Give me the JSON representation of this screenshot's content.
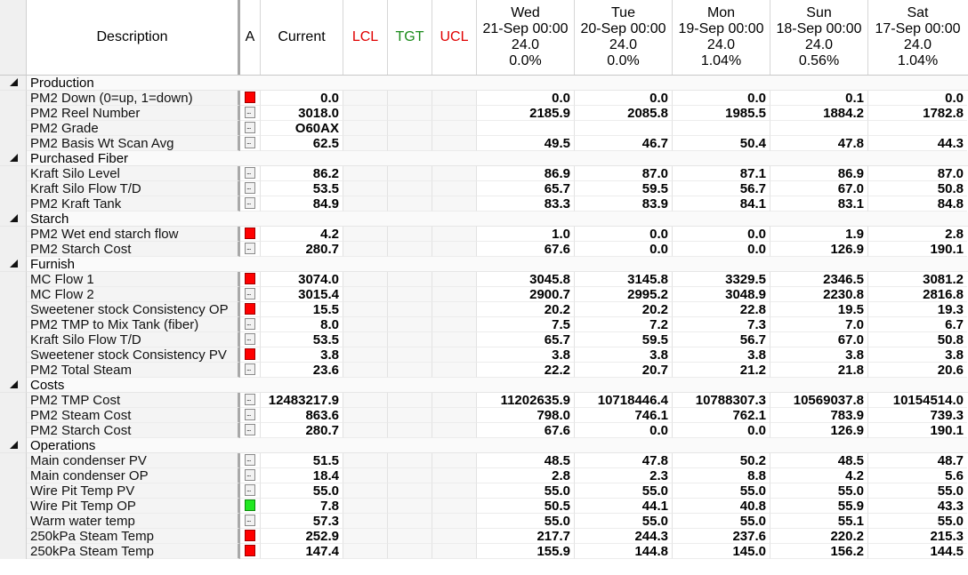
{
  "header": {
    "description": "Description",
    "a": "A",
    "current": "Current",
    "lcl": "LCL",
    "tgt": "TGT",
    "ucl": "UCL",
    "days": [
      {
        "day": "Wed",
        "date": "21-Sep 00:00",
        "hours": "24.0",
        "pct": "0.0%"
      },
      {
        "day": "Tue",
        "date": "20-Sep 00:00",
        "hours": "24.0",
        "pct": "0.0%"
      },
      {
        "day": "Mon",
        "date": "19-Sep 00:00",
        "hours": "24.0",
        "pct": "1.04%"
      },
      {
        "day": "Sun",
        "date": "18-Sep 00:00",
        "hours": "24.0",
        "pct": "0.56%"
      },
      {
        "day": "Sat",
        "date": "17-Sep 00:00",
        "hours": "24.0",
        "pct": "1.04%"
      }
    ]
  },
  "colors": {
    "alarm_red": "#ff0000",
    "alarm_green": "#22e822",
    "lcl": "#e00000",
    "tgt": "#1a8a1a",
    "ucl": "#e00000"
  },
  "groups": [
    {
      "name": "Production",
      "rows": [
        {
          "desc": "PM2 Down (0=up, 1=down)",
          "alarm": "red",
          "current": "0.0",
          "values": [
            "0.0",
            "0.0",
            "0.0",
            "0.1",
            "0.0"
          ]
        },
        {
          "desc": "PM2 Reel Number",
          "alarm": "grey",
          "current": "3018.0",
          "values": [
            "2185.9",
            "2085.8",
            "1985.5",
            "1884.2",
            "1782.8"
          ]
        },
        {
          "desc": "PM2 Grade",
          "alarm": "grey",
          "current": "O60AX",
          "values": [
            "",
            "",
            "",
            "",
            ""
          ]
        },
        {
          "desc": "PM2 Basis Wt Scan Avg",
          "alarm": "grey",
          "current": "62.5",
          "values": [
            "49.5",
            "46.7",
            "50.4",
            "47.8",
            "44.3"
          ]
        }
      ]
    },
    {
      "name": "Purchased Fiber",
      "rows": [
        {
          "desc": "Kraft Silo Level",
          "alarm": "grey",
          "current": "86.2",
          "values": [
            "86.9",
            "87.0",
            "87.1",
            "86.9",
            "87.0"
          ]
        },
        {
          "desc": "Kraft Silo Flow T/D",
          "alarm": "grey",
          "current": "53.5",
          "values": [
            "65.7",
            "59.5",
            "56.7",
            "67.0",
            "50.8"
          ]
        },
        {
          "desc": "PM2 Kraft Tank",
          "alarm": "grey",
          "current": "84.9",
          "values": [
            "83.3",
            "83.9",
            "84.1",
            "83.1",
            "84.8"
          ]
        }
      ]
    },
    {
      "name": "Starch",
      "rows": [
        {
          "desc": "PM2 Wet end starch flow",
          "alarm": "red",
          "current": "4.2",
          "values": [
            "1.0",
            "0.0",
            "0.0",
            "1.9",
            "2.8"
          ]
        },
        {
          "desc": "PM2 Starch Cost",
          "alarm": "grey",
          "current": "280.7",
          "values": [
            "67.6",
            "0.0",
            "0.0",
            "126.9",
            "190.1"
          ]
        }
      ]
    },
    {
      "name": "Furnish",
      "rows": [
        {
          "desc": "MC Flow 1",
          "alarm": "red",
          "current": "3074.0",
          "values": [
            "3045.8",
            "3145.8",
            "3329.5",
            "2346.5",
            "3081.2"
          ]
        },
        {
          "desc": "MC Flow 2",
          "alarm": "grey",
          "current": "3015.4",
          "values": [
            "2900.7",
            "2995.2",
            "3048.9",
            "2230.8",
            "2816.8"
          ]
        },
        {
          "desc": "Sweetener stock Consistency OP",
          "alarm": "red",
          "current": "15.5",
          "values": [
            "20.2",
            "20.2",
            "22.8",
            "19.5",
            "19.3"
          ]
        },
        {
          "desc": "PM2 TMP to Mix Tank (fiber)",
          "alarm": "grey",
          "current": "8.0",
          "values": [
            "7.5",
            "7.2",
            "7.3",
            "7.0",
            "6.7"
          ]
        },
        {
          "desc": "Kraft Silo Flow T/D",
          "alarm": "grey",
          "current": "53.5",
          "values": [
            "65.7",
            "59.5",
            "56.7",
            "67.0",
            "50.8"
          ]
        },
        {
          "desc": "Sweetener stock Consistency PV",
          "alarm": "red",
          "current": "3.8",
          "values": [
            "3.8",
            "3.8",
            "3.8",
            "3.8",
            "3.8"
          ]
        },
        {
          "desc": "PM2 Total Steam",
          "alarm": "grey",
          "current": "23.6",
          "values": [
            "22.2",
            "20.7",
            "21.2",
            "21.8",
            "20.6"
          ]
        }
      ]
    },
    {
      "name": "Costs",
      "rows": [
        {
          "desc": "PM2 TMP Cost",
          "alarm": "grey",
          "current": "12483217.9",
          "values": [
            "11202635.9",
            "10718446.4",
            "10788307.3",
            "10569037.8",
            "10154514.0"
          ]
        },
        {
          "desc": "PM2 Steam Cost",
          "alarm": "grey",
          "current": "863.6",
          "values": [
            "798.0",
            "746.1",
            "762.1",
            "783.9",
            "739.3"
          ]
        },
        {
          "desc": "PM2 Starch Cost",
          "alarm": "grey",
          "current": "280.7",
          "values": [
            "67.6",
            "0.0",
            "0.0",
            "126.9",
            "190.1"
          ]
        }
      ]
    },
    {
      "name": "Operations",
      "rows": [
        {
          "desc": "Main condenser PV",
          "alarm": "grey",
          "current": "51.5",
          "values": [
            "48.5",
            "47.8",
            "50.2",
            "48.5",
            "48.7"
          ]
        },
        {
          "desc": "Main condenser OP",
          "alarm": "grey",
          "current": "18.4",
          "values": [
            "2.8",
            "2.3",
            "8.8",
            "4.2",
            "5.6"
          ]
        },
        {
          "desc": "Wire Pit Temp PV",
          "alarm": "grey",
          "current": "55.0",
          "values": [
            "55.0",
            "55.0",
            "55.0",
            "55.0",
            "55.0"
          ]
        },
        {
          "desc": "Wire Pit Temp OP",
          "alarm": "green",
          "current": "7.8",
          "values": [
            "50.5",
            "44.1",
            "40.8",
            "55.9",
            "43.3"
          ]
        },
        {
          "desc": "Warm water temp",
          "alarm": "grey",
          "current": "57.3",
          "values": [
            "55.0",
            "55.0",
            "55.0",
            "55.1",
            "55.0"
          ]
        },
        {
          "desc": "250kPa Steam Temp",
          "alarm": "red",
          "current": "252.9",
          "values": [
            "217.7",
            "244.3",
            "237.6",
            "220.2",
            "215.3"
          ]
        },
        {
          "desc": "250kPa Steam Temp",
          "alarm": "red",
          "current": "147.4",
          "values": [
            "155.9",
            "144.8",
            "145.0",
            "156.2",
            "144.5"
          ]
        }
      ]
    }
  ]
}
